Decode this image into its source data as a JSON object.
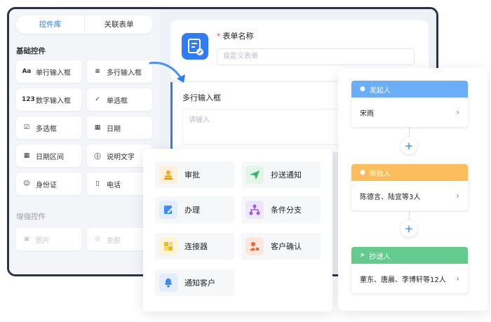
{
  "tabs": {
    "controls": "控件库",
    "related": "关联表单"
  },
  "sections": {
    "basic": "基础控件",
    "enhanced": "增强控件"
  },
  "basic_controls": [
    {
      "icon": "Aa",
      "label": "单行输入框"
    },
    {
      "icon": "≡",
      "label": "多行输入框"
    },
    {
      "icon": "123",
      "label": "数字输入框"
    },
    {
      "icon": "✓",
      "label": "单选框"
    },
    {
      "icon": "☑",
      "label": "多选框"
    },
    {
      "icon": "▦",
      "label": "日期"
    },
    {
      "icon": "▦",
      "label": "日期区间"
    },
    {
      "icon": "ⓘ",
      "label": "说明文字"
    },
    {
      "icon": "☺",
      "label": "身份证"
    },
    {
      "icon": "▯",
      "label": "电话"
    }
  ],
  "enhanced_controls": [
    {
      "icon": "▣",
      "label": "图片"
    },
    {
      "icon": "◎",
      "label": "金额"
    }
  ],
  "form": {
    "title_label": "表单名称",
    "title_placeholder": "自定义表单",
    "field_label": "多行输入框",
    "field_placeholder": "请输入"
  },
  "nodes": [
    {
      "label": "审批",
      "icon": "stamp-icon",
      "color": "#f5a623",
      "bg": "#fdf1dc"
    },
    {
      "label": "抄送通知",
      "icon": "send-icon",
      "color": "#3bb36b",
      "bg": "#e2f5ea"
    },
    {
      "label": "办理",
      "icon": "edit-icon",
      "color": "#3b8cf5",
      "bg": "#e2eefd"
    },
    {
      "label": "条件分支",
      "icon": "branch-icon",
      "color": "#9b5de5",
      "bg": "#efe6fb"
    },
    {
      "label": "连接器",
      "icon": "connector-icon",
      "color": "#f2b61f",
      "bg": "#fdf3d6"
    },
    {
      "label": "客户确认",
      "icon": "customer-icon",
      "color": "#f0643c",
      "bg": "#fde6de"
    },
    {
      "label": "通知客户",
      "icon": "bell-icon",
      "color": "#3b8cf5",
      "bg": "#e2eefd"
    }
  ],
  "flow": [
    {
      "title": "发起人",
      "value": "宋雨",
      "color": "#6aaef8"
    },
    {
      "title": "审批人",
      "value": "陈德言、陆宜等3人",
      "color": "#fcbd5c"
    },
    {
      "title": "抄送人",
      "value": "董东、唐晨、李博轩等12人",
      "color": "#63cc8c"
    }
  ],
  "colors": {
    "accent": "#2f7cf6",
    "frame": "#2b3446"
  }
}
